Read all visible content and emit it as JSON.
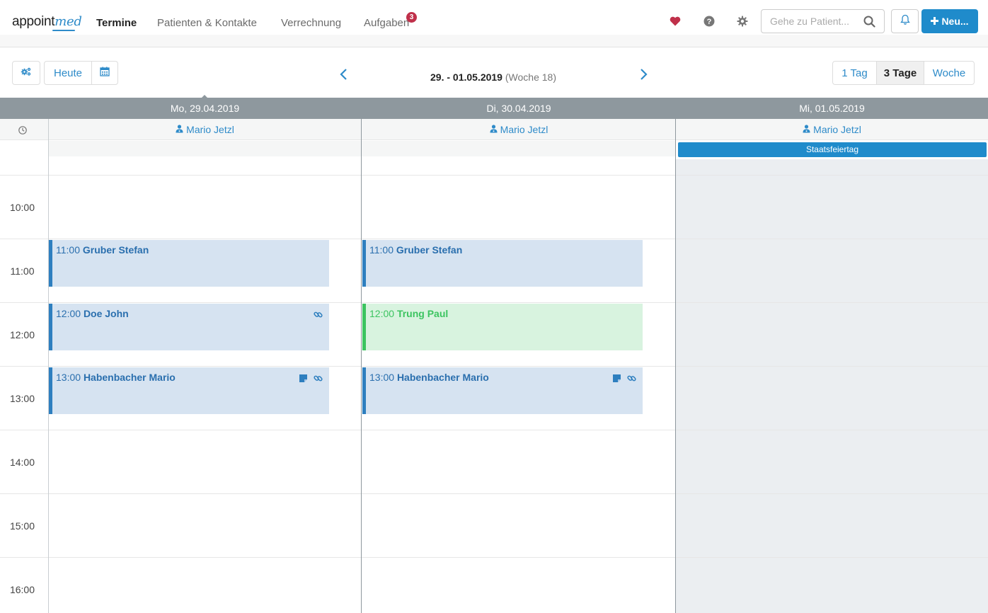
{
  "brand": {
    "part1": "appoint",
    "part2": "med"
  },
  "nav": [
    {
      "label": "Termine",
      "active": true
    },
    {
      "label": "Patienten & Kontakte"
    },
    {
      "label": "Verrechnung"
    },
    {
      "label": "Aufgaben",
      "badge": "3"
    }
  ],
  "header": {
    "search_placeholder": "Gehe zu Patient...",
    "new_label": "Neu..."
  },
  "toolbar": {
    "today": "Heute",
    "range_main": "29. - 01.05.2019",
    "range_week": "(Woche 18)",
    "views": [
      "1 Tag",
      "3 Tage",
      "Woche"
    ]
  },
  "calendar": {
    "days": [
      {
        "title": "Mo, 29.04.2019",
        "resource": "Mario Jetzl"
      },
      {
        "title": "Di, 30.04.2019",
        "resource": "Mario Jetzl"
      },
      {
        "title": "Mi, 01.05.2019",
        "resource": "Mario Jetzl",
        "holiday": "Staatsfeiertag"
      }
    ],
    "hours": [
      "10:00",
      "11:00",
      "12:00",
      "13:00",
      "14:00",
      "15:00",
      "16:00"
    ],
    "appointments": [
      {
        "day": 0,
        "time": "11:00",
        "name": "Gruber Stefan",
        "icons": []
      },
      {
        "day": 0,
        "time": "12:00",
        "name": "Doe John",
        "icons": [
          "link"
        ]
      },
      {
        "day": 0,
        "time": "13:00",
        "name": "Habenbacher Mario",
        "icons": [
          "note",
          "link"
        ]
      },
      {
        "day": 1,
        "time": "11:00",
        "name": "Gruber Stefan",
        "icons": []
      },
      {
        "day": 1,
        "time": "12:00",
        "name": "Trung Paul",
        "icons": [],
        "status": "green"
      },
      {
        "day": 1,
        "time": "13:00",
        "name": "Habenbacher Mario",
        "icons": [
          "note",
          "link"
        ]
      }
    ]
  },
  "colors": {
    "accent": "#1f8bcb",
    "header_bar": "#8e989e",
    "appt_bg": "#d6e3f1",
    "appt_green": "#3cc460",
    "badge": "#c0304a",
    "heart": "#c0304a"
  }
}
